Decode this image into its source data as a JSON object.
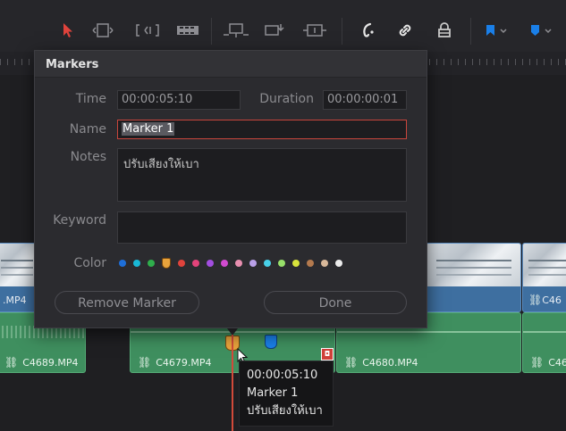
{
  "dialog": {
    "title": "Markers",
    "time_label": "Time",
    "time_value": "00:00:05:10",
    "duration_label": "Duration",
    "duration_value": "00:00:00:01",
    "name_label": "Name",
    "name_value": "Marker 1",
    "notes_label": "Notes",
    "notes_value": "ปรับเสียงให้เบา",
    "keyword_label": "Keyword",
    "keyword_value": "",
    "color_label": "Color",
    "colors": [
      "#1e6fd9",
      "#19b8d6",
      "#2fae4c",
      "#e8a33c",
      "#e0433c",
      "#e3437a",
      "#a24ee0",
      "#d24bd1",
      "#e88fb0",
      "#b9a0e8",
      "#48d0e8",
      "#98e06a",
      "#d8e33c",
      "#b47a4e",
      "#d8b89a",
      "#ececec"
    ],
    "selected_color_index": 3,
    "remove_button": "Remove Marker",
    "done_button": "Done"
  },
  "timeline": {
    "clips": {
      "video_left": ".MP4",
      "video_right": "C46",
      "audio_1": "C4689.MP4",
      "audio_2": "C4679.MP4",
      "audio_3": "C4680.MP4",
      "audio_4": "C46"
    },
    "tooltip": {
      "time": "00:00:05:10",
      "name": "Marker 1",
      "note": "ปรับเสียงให้เบา"
    }
  },
  "toolbar": {
    "icons": [
      "select-icon",
      "trim-icon",
      "dynamic-trim-icon",
      "blade-icon",
      "insert-icon",
      "overwrite-icon",
      "replace-icon",
      "snapping-icon",
      "link-icon",
      "lock-icon",
      "flag-icon",
      "marker-icon"
    ]
  }
}
